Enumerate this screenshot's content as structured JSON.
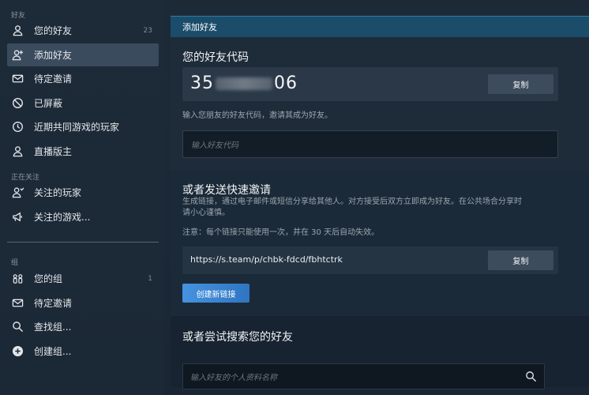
{
  "sidebar": {
    "friends_section": "好友",
    "following_section": "正在关注",
    "groups_section": "组",
    "items": [
      {
        "label": "您的好友",
        "count": "23"
      },
      {
        "label": "添加好友"
      },
      {
        "label": "待定邀请"
      },
      {
        "label": "已屏蔽"
      },
      {
        "label": "近期共同游戏的玩家"
      },
      {
        "label": "直播版主"
      }
    ],
    "following_items": [
      {
        "label": "关注的玩家"
      },
      {
        "label": "关注的游戏..."
      }
    ],
    "group_items": [
      {
        "label": "您的组",
        "count": "1"
      },
      {
        "label": "待定邀请"
      },
      {
        "label": "查找组..."
      },
      {
        "label": "创建组..."
      }
    ]
  },
  "panel": {
    "header": "添加好友",
    "code_title": "您的好友代码",
    "code_prefix": "35",
    "code_suffix": "06",
    "copy_label": "复制",
    "code_hint": "输入您朋友的好友代码，邀请其成为好友。",
    "code_placeholder": "输入好友代码",
    "invite_title": "或者发送快速邀请",
    "invite_desc_1": "生成链接，通过电子邮件或短信分享给其他人。对方接受后双方立即成为好友。在公共场合分享时",
    "invite_desc_2": "请小心谨慎。",
    "invite_note": "注意：每个链接只能使用一次，并在 30 天后自动失效。",
    "invite_link": "https://s.team/p/chbk-fdcd/fbhtctrk",
    "create_link_label": "创建新链接",
    "search_title": "或者尝试搜索您的好友",
    "search_placeholder": "输入好友的个人资料名称"
  },
  "colors": {
    "accent_header": "#1b4d6b",
    "button_blue": "#3d8ad8",
    "active_nav": "#3a4b5d"
  }
}
